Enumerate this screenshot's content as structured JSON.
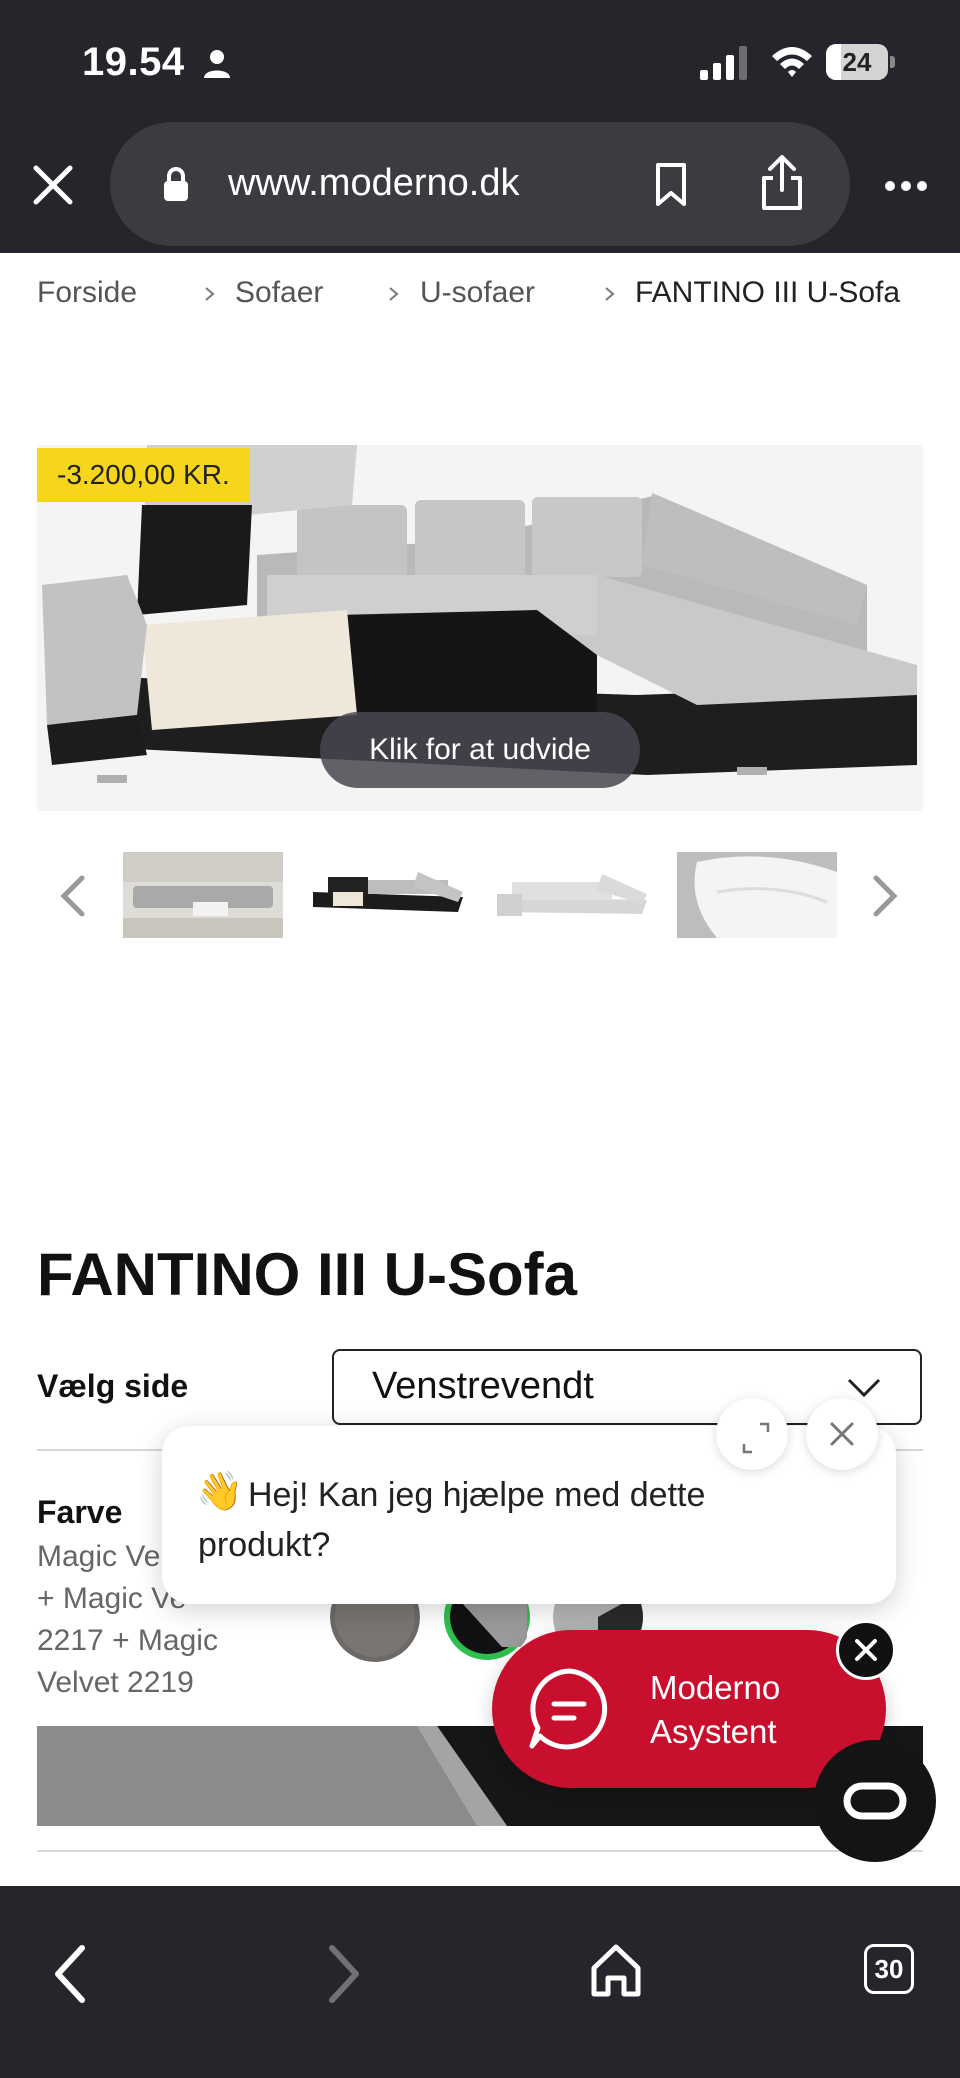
{
  "status_bar": {
    "time": "19.54",
    "battery_level": "24",
    "battery_fraction": 0.24
  },
  "browser": {
    "url": "www.moderno.dk"
  },
  "breadcrumb": [
    "Forside",
    "Sofaer",
    "U-sofaer",
    "FANTINO III U-Sofa"
  ],
  "gallery": {
    "discount_badge": "-3.200,00 KR.",
    "expand_hint": "Klik for at udvide"
  },
  "product": {
    "title": "FANTINO III U-Sofa",
    "side_label": "Vælg side",
    "side_selected": "Venstrevendt",
    "color_label": "Farve",
    "color_desc_lines": [
      "Magic Ve",
      "+ Magic Ve",
      "2217 + Magic",
      "Velvet 2219"
    ]
  },
  "chat": {
    "greeting": "Hej! Kan jeg hjælpe med dette produkt?",
    "wave_emoji": "👋",
    "assistant_label": "Moderno Asystent"
  },
  "bottom_bar": {
    "tabs_count": "30"
  },
  "colors": {
    "chrome_bg": "#24262b",
    "url_bar_bg": "#3a3c42",
    "badge_yellow": "#f5d61d",
    "assistant_red": "#c8102e",
    "selected_swatch_ring": "#2fbf4f"
  }
}
